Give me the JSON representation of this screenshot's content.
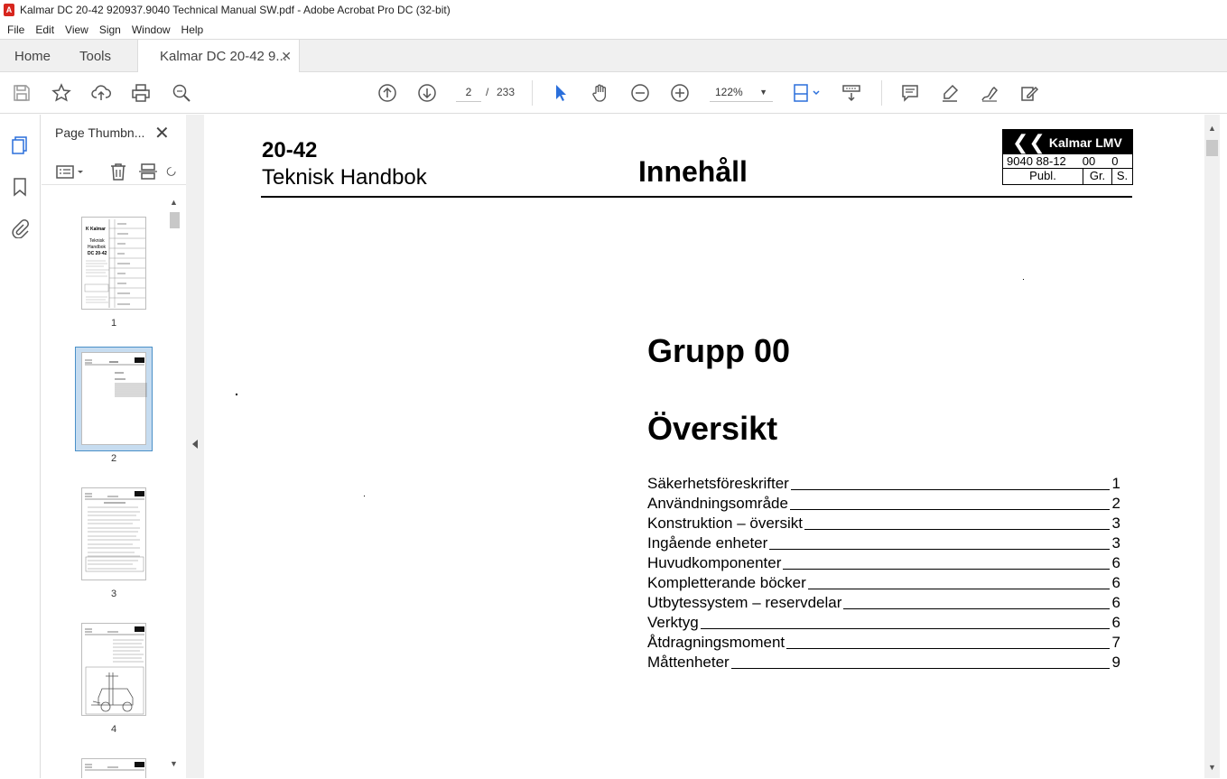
{
  "window": {
    "title": "Kalmar DC 20-42 920937.9040 Technical Manual SW.pdf - Adobe Acrobat Pro DC (32-bit)"
  },
  "menu": [
    "File",
    "Edit",
    "View",
    "Sign",
    "Window",
    "Help"
  ],
  "tabs": {
    "home": "Home",
    "tools": "Tools",
    "document": "Kalmar DC 20-42 9..."
  },
  "toolbar": {
    "current_page": "2",
    "page_separator": "/",
    "total_pages": "233",
    "zoom": "122%",
    "icons": [
      "save-icon",
      "star-icon",
      "upload-icon",
      "print-icon",
      "search-icon",
      "page-up-icon",
      "page-down-icon",
      "select-arrow-icon",
      "hand-icon",
      "zoom-out-icon",
      "zoom-in-icon",
      "fit-page-icon",
      "scroll-mode-icon",
      "comment-icon",
      "highlight-icon",
      "sign-icon",
      "edit-icon"
    ]
  },
  "thumbnails": {
    "panel_title": "Page Thumbn...",
    "pages": [
      "1",
      "2",
      "3",
      "4"
    ],
    "selected": "2"
  },
  "page": {
    "model": "20-42",
    "subtitle": "Teknisk Handbok",
    "heading": "Innehåll",
    "logo": {
      "brand": "Kalmar LMV",
      "doc_number": "9040 88-12",
      "group": "00",
      "section": "0",
      "label_publ": "Publ.",
      "label_gr": "Gr.",
      "label_s": "S."
    },
    "group_title": "Grupp 00",
    "overview_title": "Översikt",
    "toc": [
      {
        "label": "Säkerhetsföreskrifter",
        "page": "1"
      },
      {
        "label": "Användningsområde",
        "page": "2"
      },
      {
        "label": "Konstruktion – översikt ",
        "page": "3"
      },
      {
        "label": "Ingående enheter ",
        "page": "3"
      },
      {
        "label": "Huvudkomponenter ",
        "page": "6"
      },
      {
        "label": "Kompletterande böcker",
        "page": "6"
      },
      {
        "label": "Utbytessystem – reservdelar ",
        "page": "6"
      },
      {
        "label": "Verktyg ",
        "page": "6"
      },
      {
        "label": "Åtdragningsmoment ",
        "page": "7"
      },
      {
        "label": "Måttenheter",
        "page": "9"
      }
    ]
  }
}
